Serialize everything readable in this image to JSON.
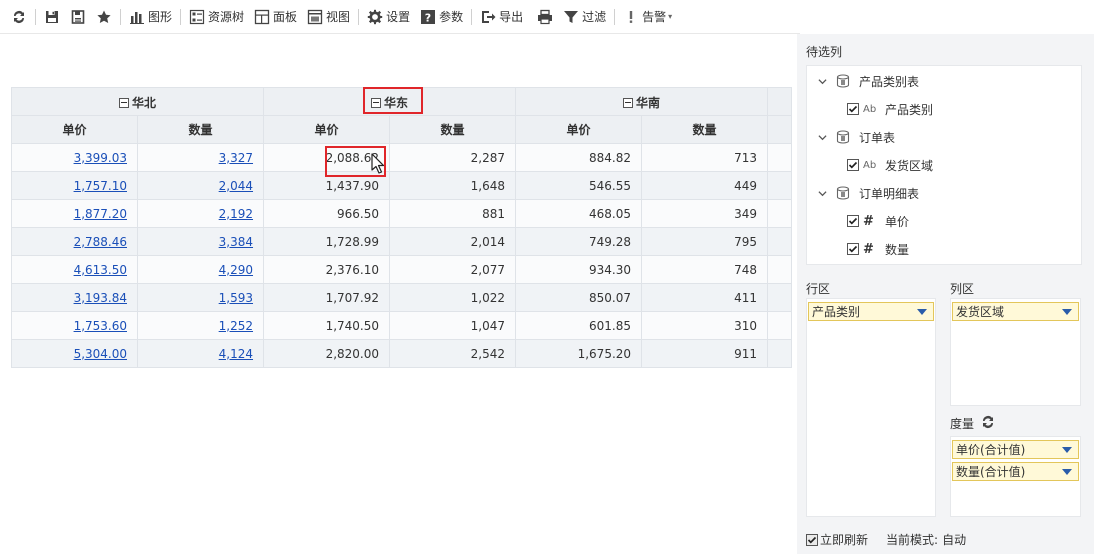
{
  "toolbar": {
    "items": [
      {
        "icon": "refresh-icon",
        "label": ""
      },
      {
        "icon": "save-icon",
        "label": ""
      },
      {
        "icon": "save-as-icon",
        "label": ""
      },
      {
        "icon": "favorite-star-icon",
        "label": ""
      },
      {
        "icon": "chart-icon",
        "label": "图形"
      },
      {
        "icon": "resource-tree-icon",
        "label": "资源树"
      },
      {
        "icon": "panel-icon",
        "label": "面板"
      },
      {
        "icon": "view-icon",
        "label": "视图"
      },
      {
        "icon": "settings-gear-icon",
        "label": "设置"
      },
      {
        "icon": "parameter-icon",
        "label": "参数"
      },
      {
        "icon": "export-icon",
        "label": "导出"
      },
      {
        "icon": "print-icon",
        "label": ""
      },
      {
        "icon": "filter-icon",
        "label": "过滤"
      },
      {
        "icon": "alert-icon",
        "label": "告警"
      }
    ]
  },
  "grid": {
    "groups": [
      "华北",
      "华东",
      "华南"
    ],
    "measures": [
      "单价",
      "数量"
    ],
    "highlighted_group": "华东",
    "rows": [
      [
        "3,399.03",
        "3,327",
        "2,088.62",
        "2,287",
        "884.82",
        "713"
      ],
      [
        "1,757.10",
        "2,044",
        "1,437.90",
        "1,648",
        "546.55",
        "449"
      ],
      [
        "1,877.20",
        "2,192",
        "966.50",
        "881",
        "468.05",
        "349"
      ],
      [
        "2,788.46",
        "3,384",
        "1,728.99",
        "2,014",
        "749.28",
        "795"
      ],
      [
        "4,613.50",
        "4,290",
        "2,376.10",
        "2,077",
        "934.30",
        "748"
      ],
      [
        "3,193.84",
        "1,593",
        "1,707.92",
        "1,022",
        "850.07",
        "411"
      ],
      [
        "1,753.60",
        "1,252",
        "1,740.50",
        "1,047",
        "601.85",
        "310"
      ],
      [
        "5,304.00",
        "4,124",
        "2,820.00",
        "2,542",
        "1,675.20",
        "911"
      ]
    ]
  },
  "panel": {
    "title": "待选列",
    "tree": [
      {
        "type": "table",
        "label": "产品类别表"
      },
      {
        "type": "field",
        "kind": "Ab",
        "label": "产品类别",
        "checked": true
      },
      {
        "type": "table",
        "label": "订单表"
      },
      {
        "type": "field",
        "kind": "Ab",
        "label": "发货区域",
        "checked": true
      },
      {
        "type": "table",
        "label": "订单明细表"
      },
      {
        "type": "field",
        "kind": "#",
        "label": "单价",
        "checked": true
      },
      {
        "type": "field",
        "kind": "#",
        "label": "数量",
        "checked": true
      }
    ],
    "row_area": {
      "label": "行区",
      "chip": "产品类别"
    },
    "col_area": {
      "label": "列区",
      "chip": "发货区域"
    },
    "measure_area": {
      "label": "度量",
      "chips": [
        "单价(合计值)",
        "数量(合计值)"
      ]
    },
    "auto_refresh": {
      "label": "立即刷新",
      "checked": true
    },
    "mode": {
      "label": "当前模式:",
      "value": "自动"
    }
  },
  "colors": {
    "accent": "#2a5caa",
    "highlight": "#e0262a",
    "link": "#1a4fb8",
    "chip_bg": "#fff9d8",
    "chip_border": "#e3c65a"
  }
}
